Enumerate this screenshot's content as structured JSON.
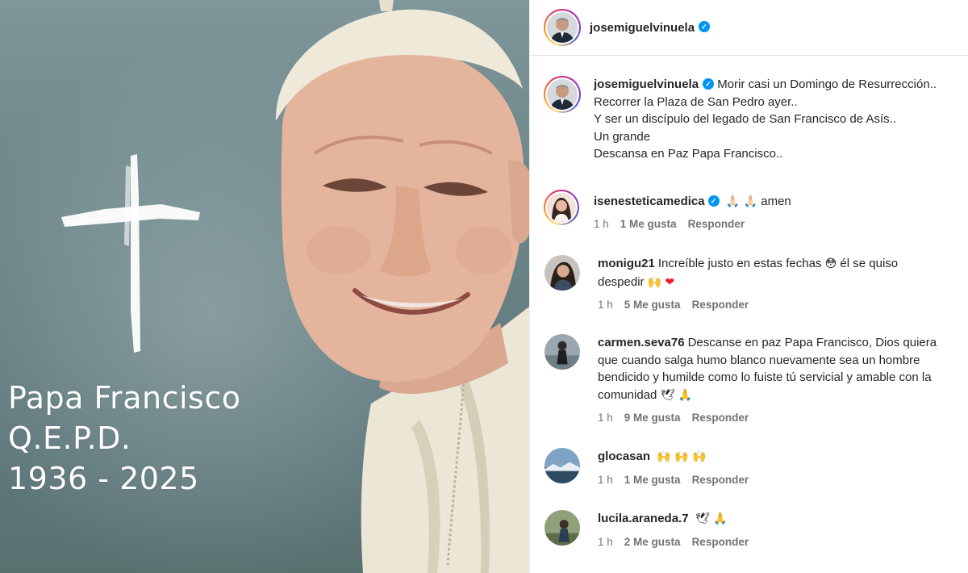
{
  "post_image": {
    "memorial_lines": [
      "Papa Francisco",
      "Q.E.P.D.",
      "1936 - 2025"
    ]
  },
  "header": {
    "username": "josemiguelvinuela",
    "verified": true
  },
  "caption": {
    "username": "josemiguelvinuela",
    "lines": [
      "Morir casi un Domingo de Resurrección..",
      "Recorrer la Plaza de San Pedro ayer..",
      "Y ser un discípulo del legado de San Francisco de Asís..",
      "Un grande",
      "Descansa en Paz Papa Francisco.."
    ]
  },
  "comments": [
    {
      "username": "isenesteticamedica",
      "verified": true,
      "emoji": "🙏🏻 🙏🏻",
      "text": "amen",
      "time": "1 h",
      "likes": "1 Me gusta",
      "reply": "Responder"
    },
    {
      "username": "monigu21",
      "text": "Increíble justo en estas fechas",
      "emoji1": "😳",
      "text2": "él se quiso",
      "text3": "despedir",
      "emoji2": "🙌",
      "heart": "❤",
      "time": "1 h",
      "likes": "5 Me gusta",
      "reply": "Responder"
    },
    {
      "username": "carmen.seva76",
      "line1": "Descanse en paz Papa Francisco, Dios quiera",
      "line2": "que cuando salga humo blanco nuevamente sea un hombre",
      "line3": "bendicido y humilde como lo fuiste tú servicial y amable con la",
      "line4": "comunidad",
      "emoji": "🕊 🙏",
      "time": "1 h",
      "likes": "9 Me gusta",
      "reply": "Responder"
    },
    {
      "username": "glocasan",
      "emoji": "🙌 🙌 🙌",
      "time": "1 h",
      "likes": "1 Me gusta",
      "reply": "Responder"
    },
    {
      "username": "lucila.araneda.7",
      "emoji": "🕊 🙏",
      "time": "1 h",
      "likes": "2 Me gusta",
      "reply": "Responder"
    }
  ],
  "colors": {
    "verified": "#0095f6",
    "text": "#262626",
    "meta": "#737373"
  }
}
